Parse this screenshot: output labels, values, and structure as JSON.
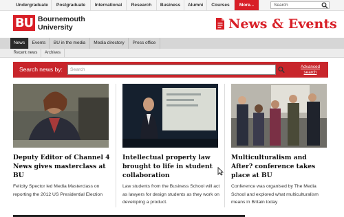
{
  "topnav": {
    "items": [
      "Undergraduate",
      "Postgraduate",
      "International",
      "Research",
      "Business",
      "Alumni",
      "Courses"
    ],
    "more_label": "More...",
    "search_placeholder": "Search"
  },
  "header": {
    "logo_mark": "BU",
    "logo_line1": "Bournemouth",
    "logo_line2": "University",
    "section_title": "News & Events",
    "icon": "document-icon"
  },
  "section_nav": {
    "items": [
      "News",
      "Events",
      "BU in the media",
      "Media directory",
      "Press office"
    ],
    "active": "News"
  },
  "sub_nav": {
    "items": [
      "Recent news",
      "Archives"
    ]
  },
  "news_search": {
    "label": "Search news by:",
    "placeholder": "Search",
    "advanced_line1": "Advanced",
    "advanced_line2": "search"
  },
  "articles": [
    {
      "headline": "Deputy Editor of Channel 4 News gives masterclass at BU",
      "summary": "Felicity Spector led Media Masterclass on reporting the 2012 US Presidential Election"
    },
    {
      "headline": "Intellectual property law brought to life in student collaboration",
      "summary": "Law students from the Business School will act as lawyers for design students as they work on developing a product."
    },
    {
      "headline": "Multiculturalism and After? conference takes place at BU",
      "summary": "Conference was organised by The Media School and explored what multiculturalism means in Britain today"
    }
  ],
  "colors": {
    "brand_red": "#d81f27",
    "search_bar_red": "#c8252b",
    "active_nav": "#2b2b2b"
  }
}
